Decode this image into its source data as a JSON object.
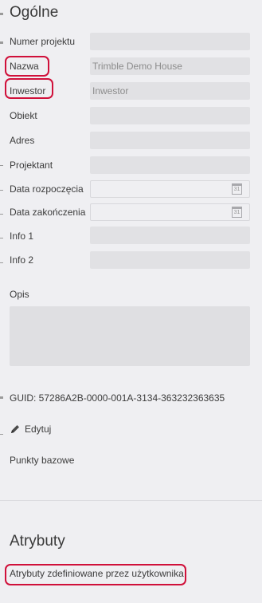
{
  "general": {
    "title": "Ogólne",
    "fields": {
      "project_number": {
        "label": "Numer projektu",
        "value": ""
      },
      "name": {
        "label": "Nazwa",
        "value": "Trimble Demo House"
      },
      "investor": {
        "label": "Inwestor",
        "value": "Inwestor"
      },
      "object": {
        "label": "Obiekt",
        "value": ""
      },
      "address": {
        "label": "Adres",
        "value": ""
      },
      "designer": {
        "label": "Projektant",
        "value": ""
      },
      "start_date": {
        "label": "Data rozpoczęcia",
        "value": ""
      },
      "end_date": {
        "label": "Data zakończenia",
        "value": ""
      },
      "info1": {
        "label": "Info 1",
        "value": ""
      },
      "info2": {
        "label": "Info 2",
        "value": ""
      }
    },
    "description_label": "Opis",
    "description_value": "",
    "calendar_day": "31",
    "guid": "GUID: 57286A2B-0000-001A-3134-363232363635",
    "edit_label": "Edytuj",
    "base_points_label": "Punkty bazowe",
    "icons": {
      "edit": "pencil-icon",
      "calendar": "calendar-icon"
    }
  },
  "attributes": {
    "title": "Atrybuty",
    "user_defined_link": "Atrybuty zdefiniowane przez użytkownika"
  },
  "highlight_color": "#d0103a"
}
